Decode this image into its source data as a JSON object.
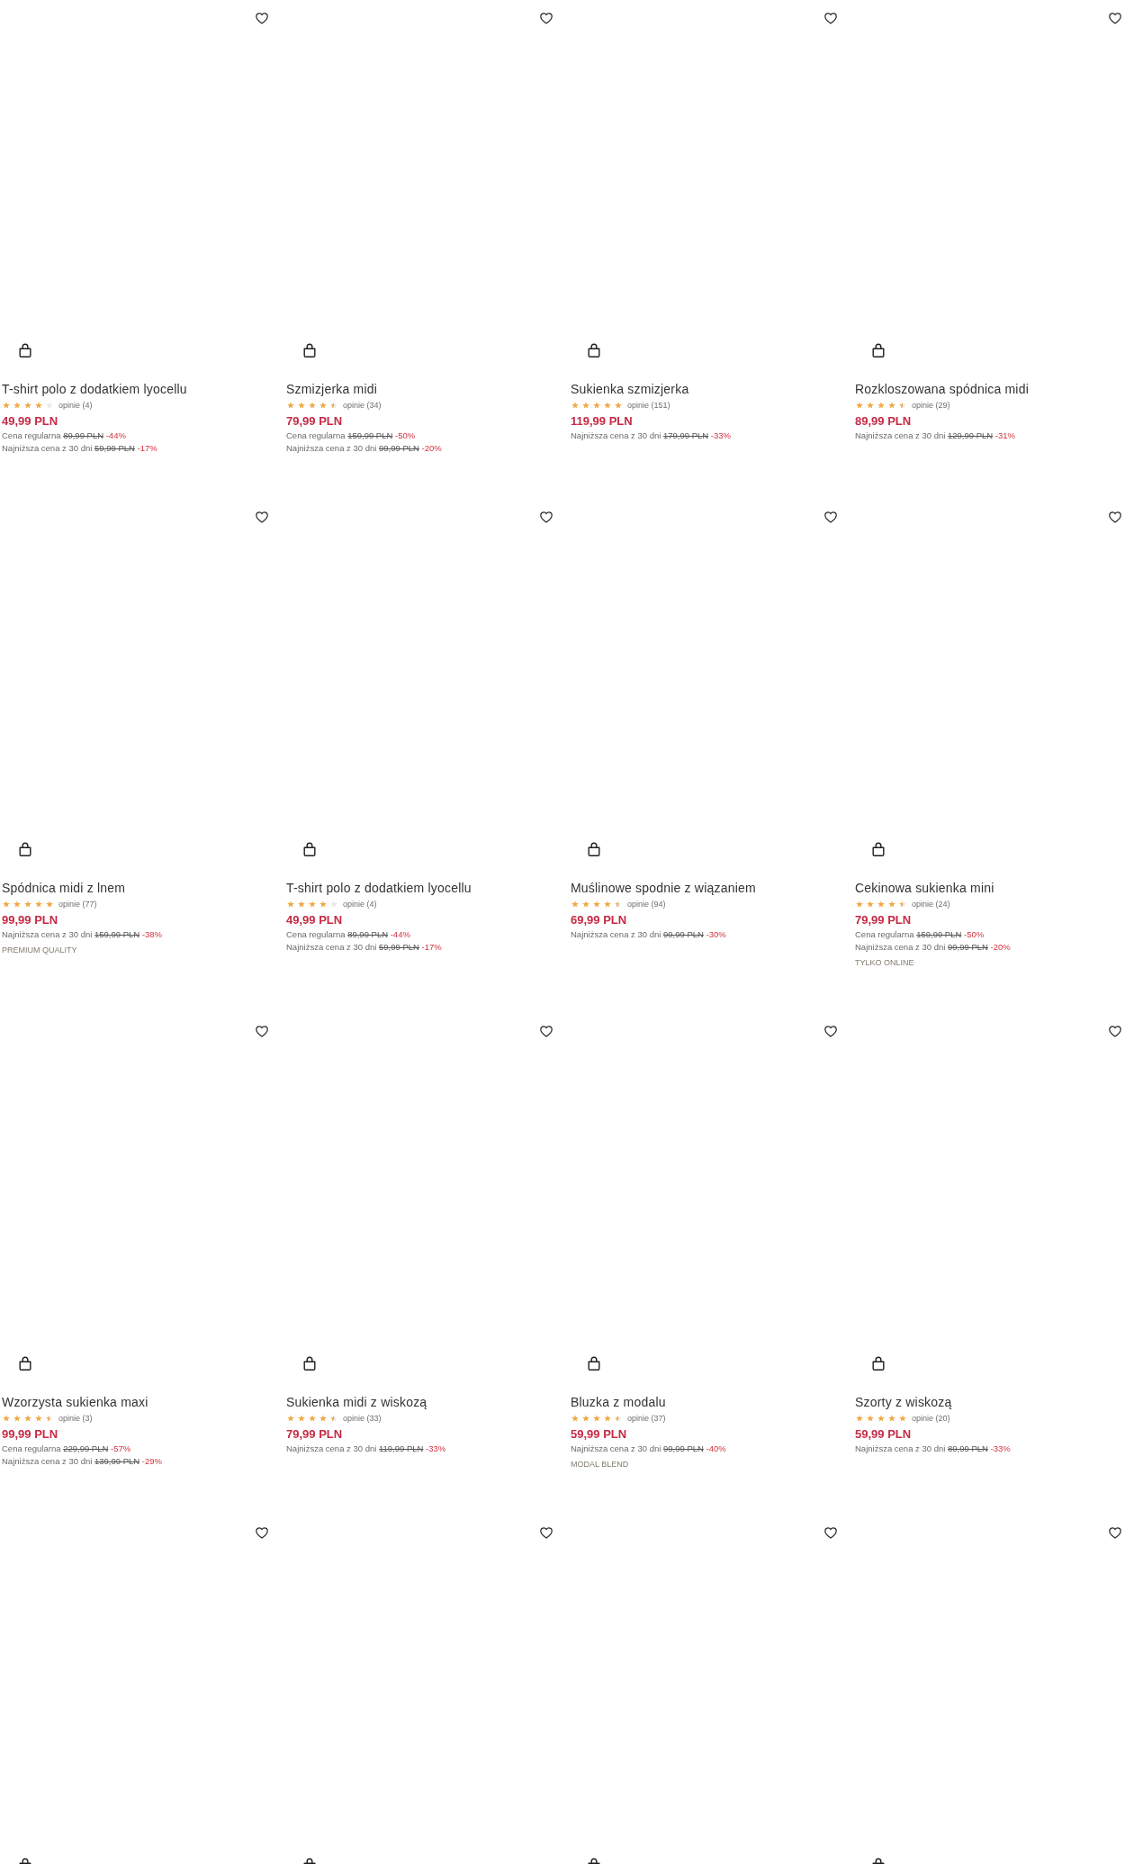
{
  "products": [
    {
      "wishlisted": false,
      "title": "T-shirt polo z dodatkiem lyocellu",
      "stars": 4,
      "reviews": "opinie (4)",
      "price": "49,99 PLN",
      "price_notes": [
        {
          "label": "Cena regularna",
          "old_price": "89,99 PLN",
          "discount": "-44%"
        },
        {
          "label": "Najniższa cena z 30 dni",
          "old_price": "59,99 PLN",
          "discount": "-17%"
        }
      ]
    },
    {
      "wishlisted": false,
      "title": "Szmizjerka midi",
      "stars": 4.5,
      "reviews": "opinie (34)",
      "price": "79,99 PLN",
      "price_notes": [
        {
          "label": "Cena regularna",
          "old_price": "159,99 PLN",
          "discount": "-50%"
        },
        {
          "label": "Najniższa cena z 30 dni",
          "old_price": "99,99 PLN",
          "discount": "-20%"
        }
      ]
    },
    {
      "wishlisted": false,
      "title": "Sukienka szmizjerka",
      "stars": 5,
      "reviews": "opinie (151)",
      "price": "119,99 PLN",
      "price_notes": [
        {
          "label": "Najniższa cena z 30 dni",
          "old_price": "179,99 PLN",
          "discount": "-33%"
        }
      ]
    },
    {
      "wishlisted": false,
      "title": "Rozkloszowana spódnica midi",
      "stars": 4.5,
      "reviews": "opinie (29)",
      "price": "89,99 PLN",
      "price_notes": [
        {
          "label": "Najniższa cena z 30 dni",
          "old_price": "129,99 PLN",
          "discount": "-31%"
        }
      ]
    },
    {
      "wishlisted": false,
      "title": "Spódnica midi z lnem",
      "stars": 5,
      "reviews": "opinie (77)",
      "price": "99,99 PLN",
      "price_notes": [
        {
          "label": "Najniższa cena z 30 dni",
          "old_price": "159,99 PLN",
          "discount": "-38%"
        }
      ],
      "tag": "PREMIUM QUALITY"
    },
    {
      "wishlisted": false,
      "title": "T-shirt polo z dodatkiem lyocellu",
      "stars": 4,
      "reviews": "opinie (4)",
      "price": "49,99 PLN",
      "price_notes": [
        {
          "label": "Cena regularna",
          "old_price": "89,99 PLN",
          "discount": "-44%"
        },
        {
          "label": "Najniższa cena z 30 dni",
          "old_price": "59,99 PLN",
          "discount": "-17%"
        }
      ]
    },
    {
      "wishlisted": false,
      "title": "Muślinowe spodnie z wiązaniem",
      "stars": 4.5,
      "reviews": "opinie (94)",
      "price": "69,99 PLN",
      "price_notes": [
        {
          "label": "Najniższa cena z 30 dni",
          "old_price": "99,99 PLN",
          "discount": "-30%"
        }
      ]
    },
    {
      "wishlisted": false,
      "title": "Cekinowa sukienka mini",
      "stars": 4.5,
      "reviews": "opinie (24)",
      "price": "79,99 PLN",
      "price_notes": [
        {
          "label": "Cena regularna",
          "old_price": "159,99 PLN",
          "discount": "-50%"
        },
        {
          "label": "Najniższa cena z 30 dni",
          "old_price": "99,99 PLN",
          "discount": "-20%"
        }
      ],
      "tag": "TYLKO ONLINE"
    },
    {
      "wishlisted": false,
      "title": "Wzorzysta sukienka maxi",
      "stars": 4.5,
      "reviews": "opinie (3)",
      "price": "99,99 PLN",
      "price_notes": [
        {
          "label": "Cena regularna",
          "old_price": "229,99 PLN",
          "discount": "-57%"
        },
        {
          "label": "Najniższa cena z 30 dni",
          "old_price": "139,99 PLN",
          "discount": "-29%"
        }
      ]
    },
    {
      "wishlisted": false,
      "title": "Sukienka midi z wiskozą",
      "stars": 4.5,
      "reviews": "opinie (33)",
      "price": "79,99 PLN",
      "price_notes": [
        {
          "label": "Najniższa cena z 30 dni",
          "old_price": "119,99 PLN",
          "discount": "-33%"
        }
      ]
    },
    {
      "wishlisted": false,
      "title": "Bluzka z modalu",
      "stars": 4.5,
      "reviews": "opinie (37)",
      "price": "59,99 PLN",
      "price_notes": [
        {
          "label": "Najniższa cena z 30 dni",
          "old_price": "99,99 PLN",
          "discount": "-40%"
        }
      ],
      "tag": "MODAL BLEND"
    },
    {
      "wishlisted": false,
      "title": "Szorty z wiskozą",
      "stars": 5,
      "reviews": "opinie (20)",
      "price": "59,99 PLN",
      "price_notes": [
        {
          "label": "Najniższa cena z 30 dni",
          "old_price": "89,99 PLN",
          "discount": "-33%"
        }
      ]
    },
    {
      "wishlisted": false
    },
    {
      "wishlisted": false
    },
    {
      "wishlisted": false
    },
    {
      "wishlisted": false
    }
  ]
}
